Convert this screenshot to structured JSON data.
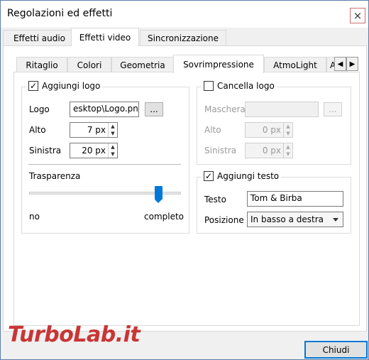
{
  "window": {
    "title": "Regolazioni ed effetti",
    "close_icon": "×"
  },
  "main_tabs": [
    "Effetti audio",
    "Effetti video",
    "Sincronizzazione"
  ],
  "sub_tabs": [
    "Ritaglio",
    "Colori",
    "Geometria",
    "Sovrimpressione",
    "AtmoLight",
    "A"
  ],
  "logo_group": {
    "title": "Aggiungi logo",
    "checked": true,
    "logo_label": "Logo",
    "logo_value": "esktop\\Logo.png",
    "browse": "...",
    "alto_label": "Alto",
    "alto_value": "7 px",
    "sinistra_label": "Sinistra",
    "sinistra_value": "20 px",
    "trasparenza_label": "Trasparenza",
    "slider_min": "no",
    "slider_max": "completo",
    "slider_level": 0.85
  },
  "cancella_group": {
    "title": "Cancella logo",
    "checked": false,
    "maschera_label": "Maschera",
    "maschera_value": "",
    "browse": "...",
    "alto_label": "Alto",
    "alto_value": "0 px",
    "sinistra_label": "Sinistra",
    "sinistra_value": "0 px"
  },
  "testo_group": {
    "title": "Aggiungi testo",
    "checked": true,
    "testo_label": "Testo",
    "testo_value": "Tom & Birba",
    "posizione_label": "Posizione",
    "posizione_value": "In basso a destra"
  },
  "footer": {
    "close_button": "Chiudi",
    "watermark": "TurboLab.it"
  },
  "checkmark": "✓",
  "arrows": {
    "left": "◀",
    "right": "▶",
    "up": "▲",
    "down": "▼"
  }
}
